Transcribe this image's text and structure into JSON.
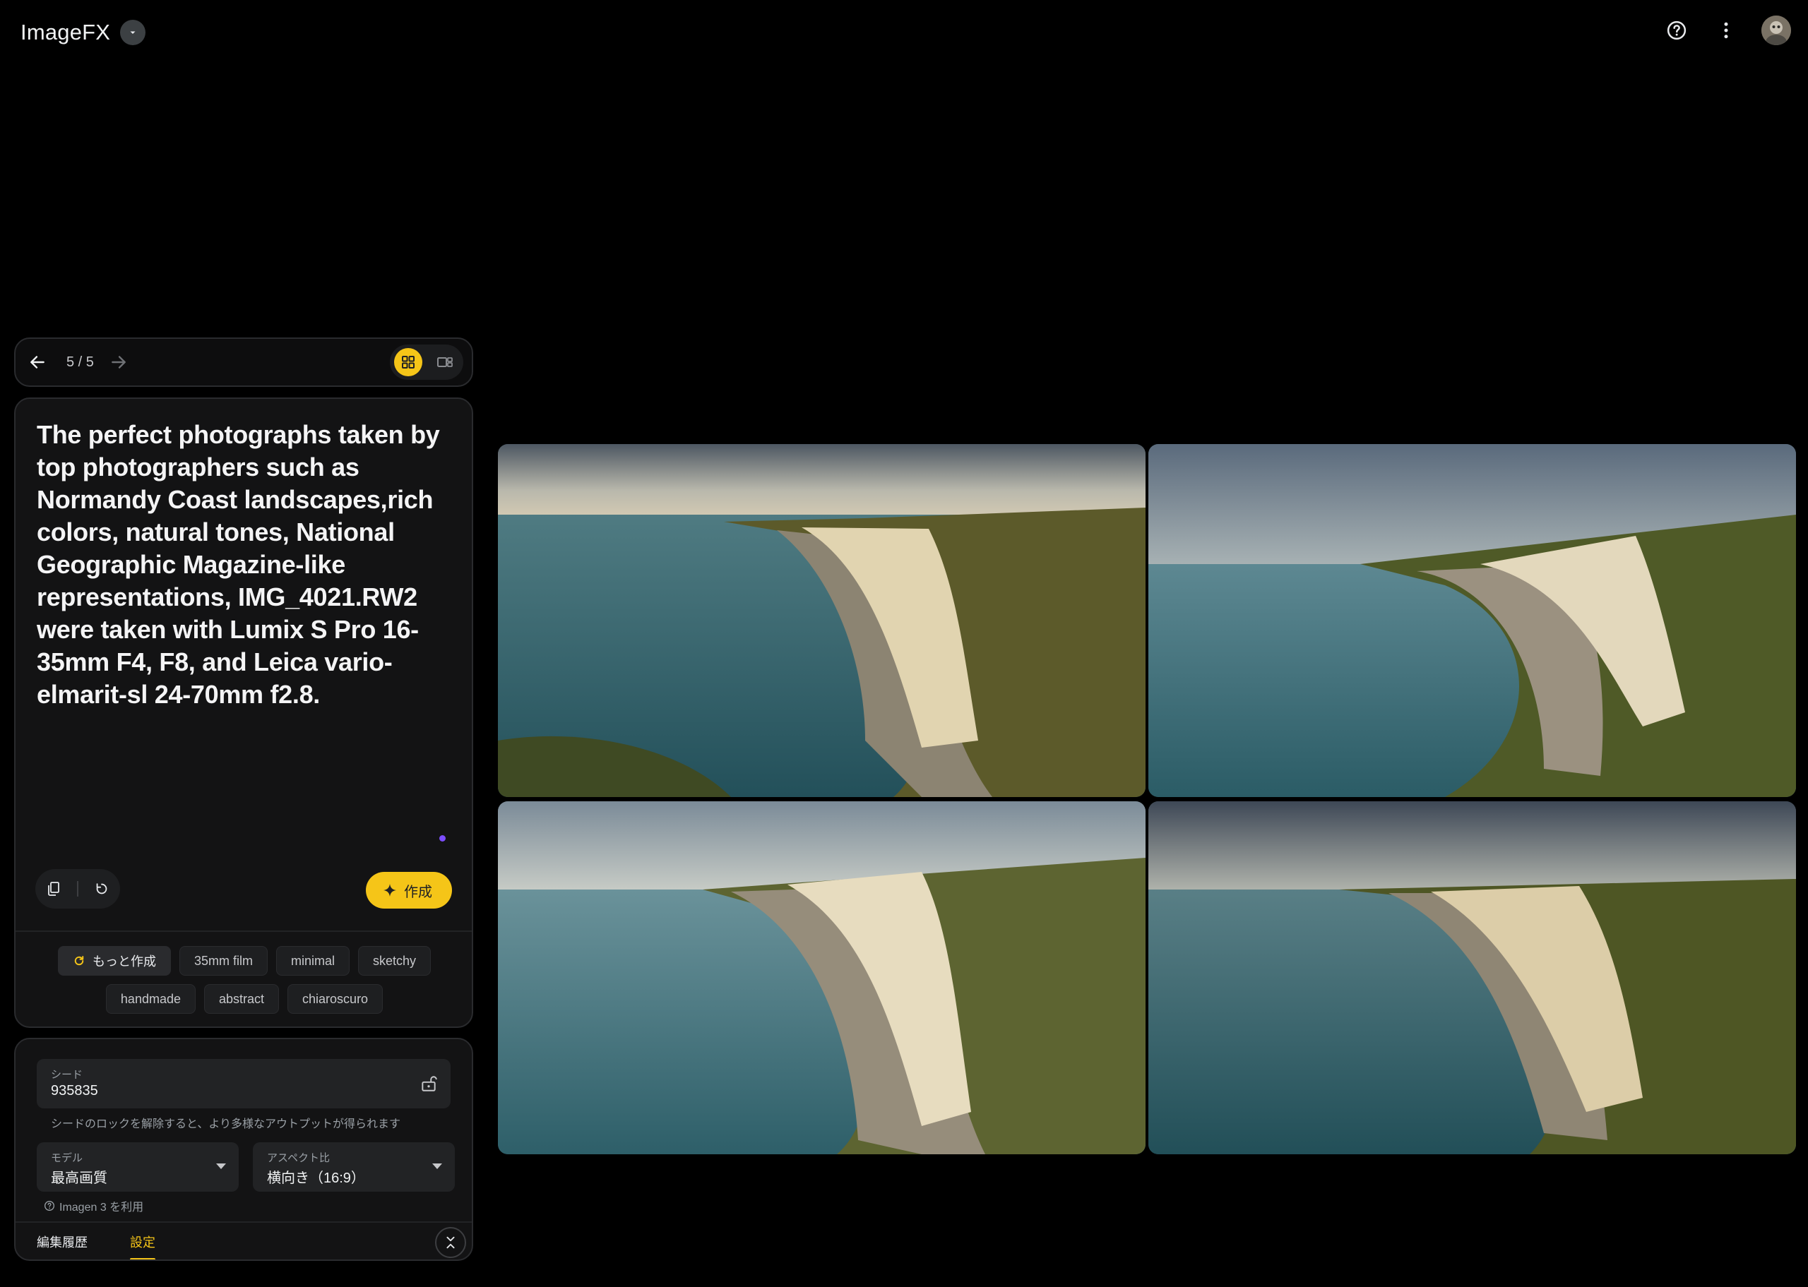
{
  "app": {
    "title": "ImageFX"
  },
  "header": {
    "icons": [
      "help-icon",
      "more-vert-icon",
      "avatar"
    ]
  },
  "nav": {
    "counter": "5 / 5"
  },
  "prompt": {
    "text": "The perfect photographs taken by top photographers such as Normandy Coast landscapes,rich colors, natural tones, National Geographic Magazine-like representations, IMG_4021.RW2 were taken with Lumix S Pro 16-35mm F4, F8, and Leica vario-elmarit-sl 24-70mm f2.8.",
    "create_label": "作成"
  },
  "chips": {
    "more_label": "もっと作成",
    "items": [
      "35mm film",
      "minimal",
      "sketchy",
      "handmade",
      "abstract",
      "chiaroscuro"
    ]
  },
  "settings": {
    "seed_label": "シード",
    "seed_value": "935835",
    "seed_hint": "シードのロックを解除すると、より多様なアウトプットが得られます",
    "model_label": "モデル",
    "model_value": "最高画質",
    "aspect_label": "アスペクト比",
    "aspect_value": "横向き（16:9）",
    "note": "Imagen 3 を利用"
  },
  "tabs": {
    "history": "編集履歴",
    "settings": "設定"
  },
  "colors": {
    "accent": "#f5c518",
    "background": "#000000",
    "panel": "#131314"
  }
}
